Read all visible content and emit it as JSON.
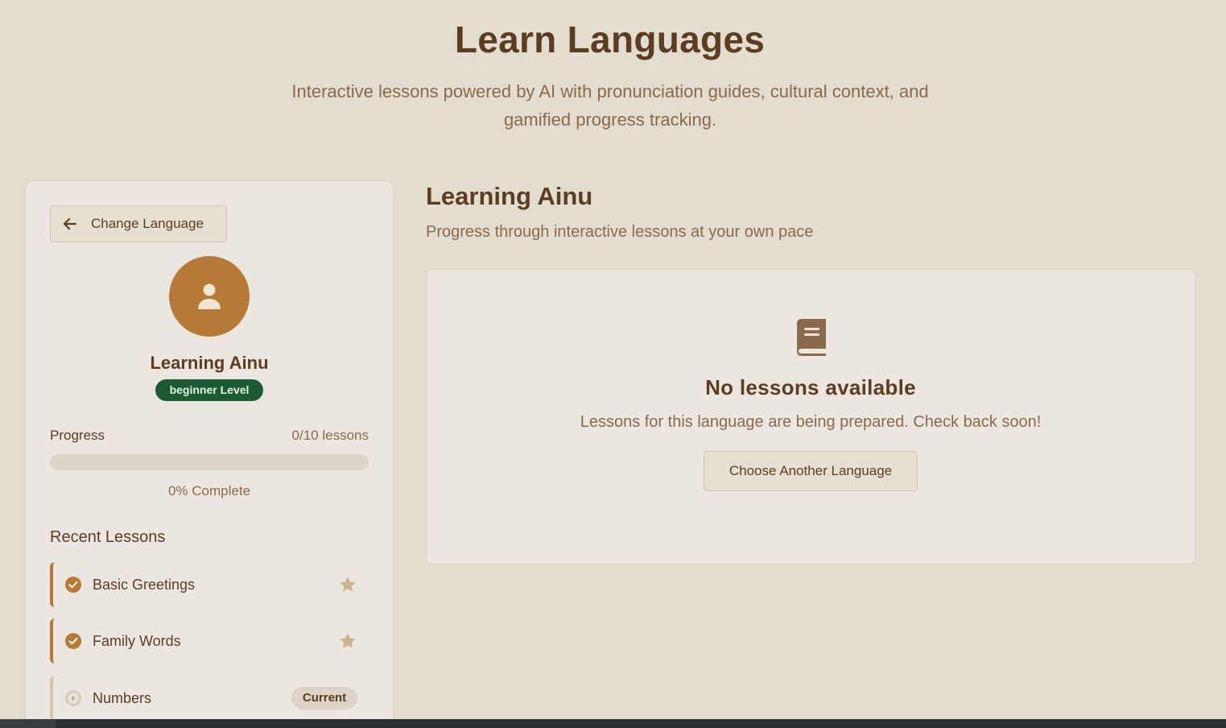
{
  "hero": {
    "title": "Learn Languages",
    "subtitle": "Interactive lessons powered by AI with pronunciation guides, cultural context, and gamified progress tracking."
  },
  "sidebar": {
    "back_button_label": "Change Language",
    "back_icon": "arrow-left-icon",
    "avatar_icon": "user-icon",
    "title": "Learning Ainu",
    "level_badge": "beginner Level",
    "progress": {
      "label": "Progress",
      "count": "0/10 lessons",
      "percent": 0,
      "percent_text": "0% Complete"
    },
    "recent_heading": "Recent Lessons",
    "lessons": [
      {
        "name": "Basic Greetings",
        "status": "completed",
        "status_icon": "check-circle-icon",
        "trailing": "star-icon"
      },
      {
        "name": "Family Words",
        "status": "completed",
        "status_icon": "check-circle-icon",
        "trailing": "star-icon"
      },
      {
        "name": "Numbers",
        "status": "current",
        "status_icon": "play-circle-icon",
        "badge": "Current"
      }
    ]
  },
  "main": {
    "title": "Learning Ainu",
    "subtitle": "Progress through interactive lessons at your own pace",
    "empty_state": {
      "icon": "book-icon",
      "heading": "No lessons available",
      "message": "Lessons for this language are being prepared. Check back soon!",
      "button_label": "Choose Another Language"
    }
  },
  "colors": {
    "background": "#e2ddcf",
    "card": "#ebe7e0",
    "accent": "#b57a38",
    "text_dark": "#5c3d22",
    "text_muted": "#8b6a4c",
    "level_badge": "#1c5a34"
  }
}
